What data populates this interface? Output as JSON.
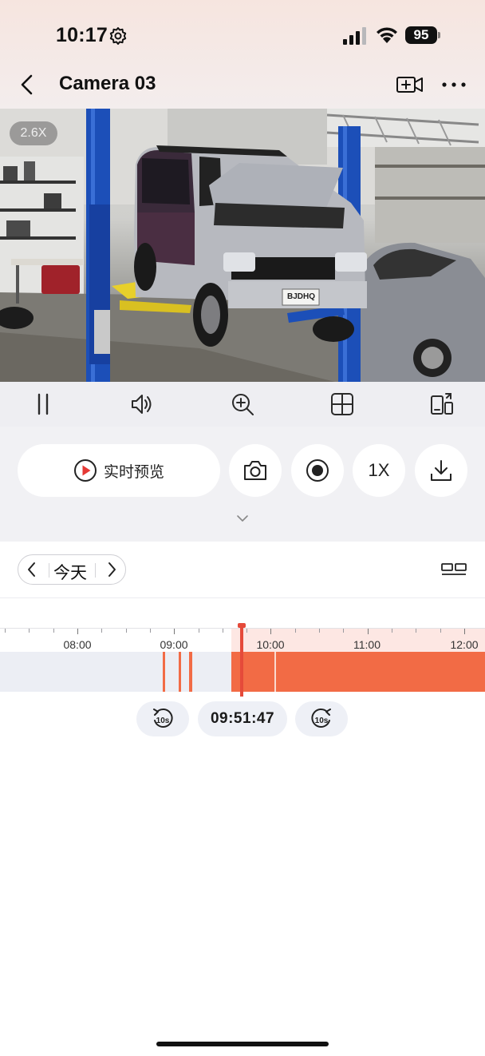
{
  "status_bar": {
    "time": "10:17",
    "battery": "95"
  },
  "header": {
    "title": "Camera 03"
  },
  "video": {
    "zoom_level": "2.6X",
    "plate_text": "BJDHQ"
  },
  "controls": {
    "live_label": "实时预览",
    "speed_label": "1X"
  },
  "timeline": {
    "day_label": "今天",
    "hour_labels": [
      "08:00",
      "09:00",
      "10:00",
      "11:00",
      "12:00"
    ],
    "current_time": "09:51:47",
    "skip_back_label": "10s",
    "skip_forward_label": "10s"
  },
  "colors": {
    "recording": "#f26b45",
    "playhead": "#e54a3a",
    "accent": "#e53935"
  }
}
